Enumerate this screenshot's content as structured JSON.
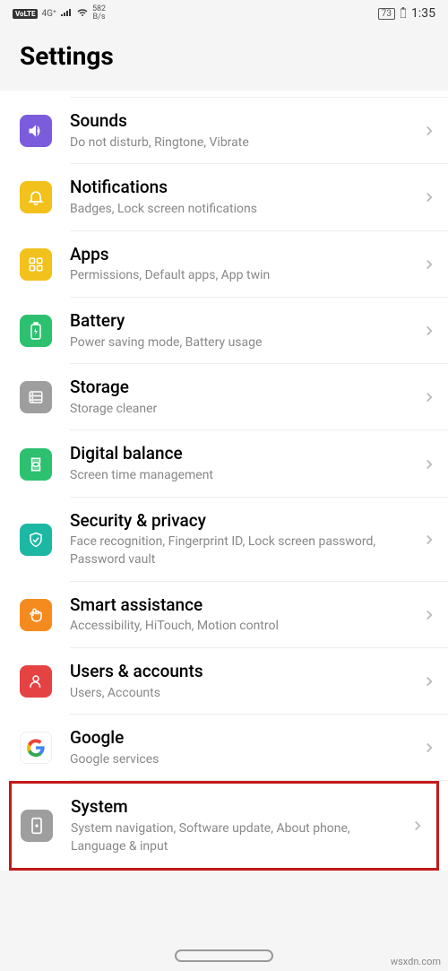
{
  "status": {
    "volte": "VoLTE",
    "net": "4G⁺",
    "speed_top": "582",
    "speed_bot": "B/s",
    "battery": "73",
    "time": "1:35"
  },
  "title": "Settings",
  "rows": [
    {
      "id": "sounds",
      "title": "Sounds",
      "sub": "Do not disturb, Ringtone, Vibrate",
      "color": "#7a5cdc"
    },
    {
      "id": "notifications",
      "title": "Notifications",
      "sub": "Badges, Lock screen notifications",
      "color": "#f2c11c"
    },
    {
      "id": "apps",
      "title": "Apps",
      "sub": "Permissions, Default apps, App twin",
      "color": "#f2c11c"
    },
    {
      "id": "battery",
      "title": "Battery",
      "sub": "Power saving mode, Battery usage",
      "color": "#2cc06f"
    },
    {
      "id": "storage",
      "title": "Storage",
      "sub": "Storage cleaner",
      "color": "#9e9e9e"
    },
    {
      "id": "digital-balance",
      "title": "Digital balance",
      "sub": "Screen time management",
      "color": "#2cc06f"
    },
    {
      "id": "security",
      "title": "Security & privacy",
      "sub": "Face recognition, Fingerprint ID, Lock screen password, Password vault",
      "color": "#1db8a4"
    },
    {
      "id": "smart-assistance",
      "title": "Smart assistance",
      "sub": "Accessibility, HiTouch, Motion control",
      "color": "#f58b1f"
    },
    {
      "id": "users",
      "title": "Users & accounts",
      "sub": "Users, Accounts",
      "color": "#e54243"
    },
    {
      "id": "google",
      "title": "Google",
      "sub": "Google services",
      "color": "#ffffff"
    },
    {
      "id": "system",
      "title": "System",
      "sub": "System navigation, Software update, About phone, Language & input",
      "color": "#9e9e9e"
    }
  ],
  "watermark": "wsxdn.com"
}
